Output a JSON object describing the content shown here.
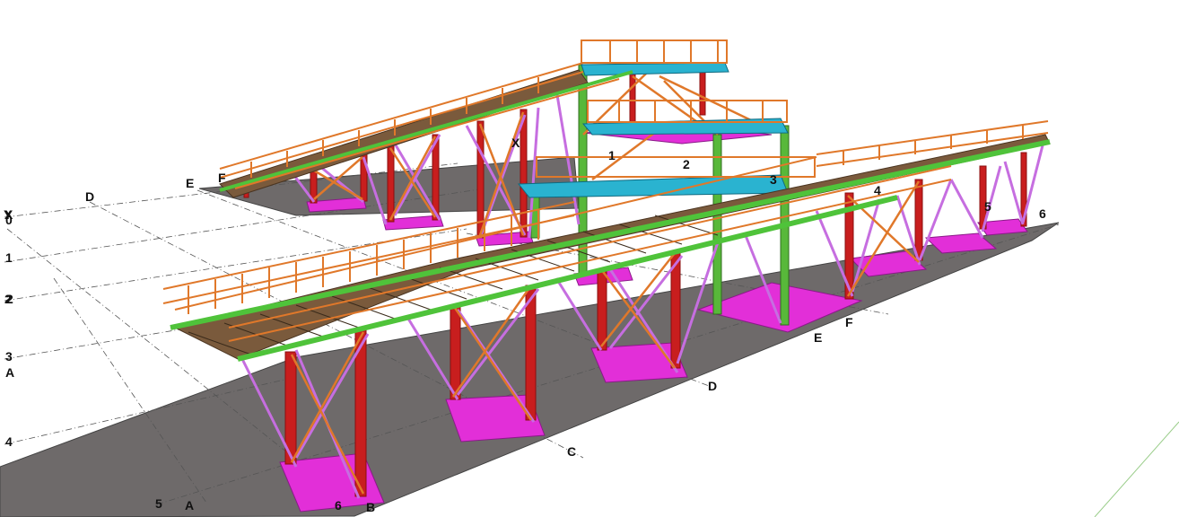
{
  "grid_labels": {
    "left_1": "1",
    "left_2a": "2",
    "left_2b": "2",
    "left_3": "3",
    "left_4": "4",
    "left_5": "5",
    "left_6": "6",
    "left_x": "X",
    "left_y": "Y",
    "left_0": "0",
    "left_a": "A",
    "bottom_a": "A",
    "bottom_b": "B",
    "right_c": "C",
    "right_d": "D",
    "right_e": "E",
    "right_f": "F",
    "far_d": "D",
    "far_e": "E",
    "far_f": "F",
    "upper_x": "X",
    "tower_1": "1",
    "tower_2": "2",
    "tower_3": "3",
    "right_4": "4",
    "right_5": "5",
    "right_6": "6"
  },
  "colors": {
    "ground": "#6e6a6a",
    "foundation": "#e22fd8",
    "column": "#c81e1e",
    "railing": "#e0782a",
    "beam": "#4fc33a",
    "bracing": "#c66ee0",
    "platform": "#2ab3d0",
    "grating": "#7a5a3c"
  }
}
